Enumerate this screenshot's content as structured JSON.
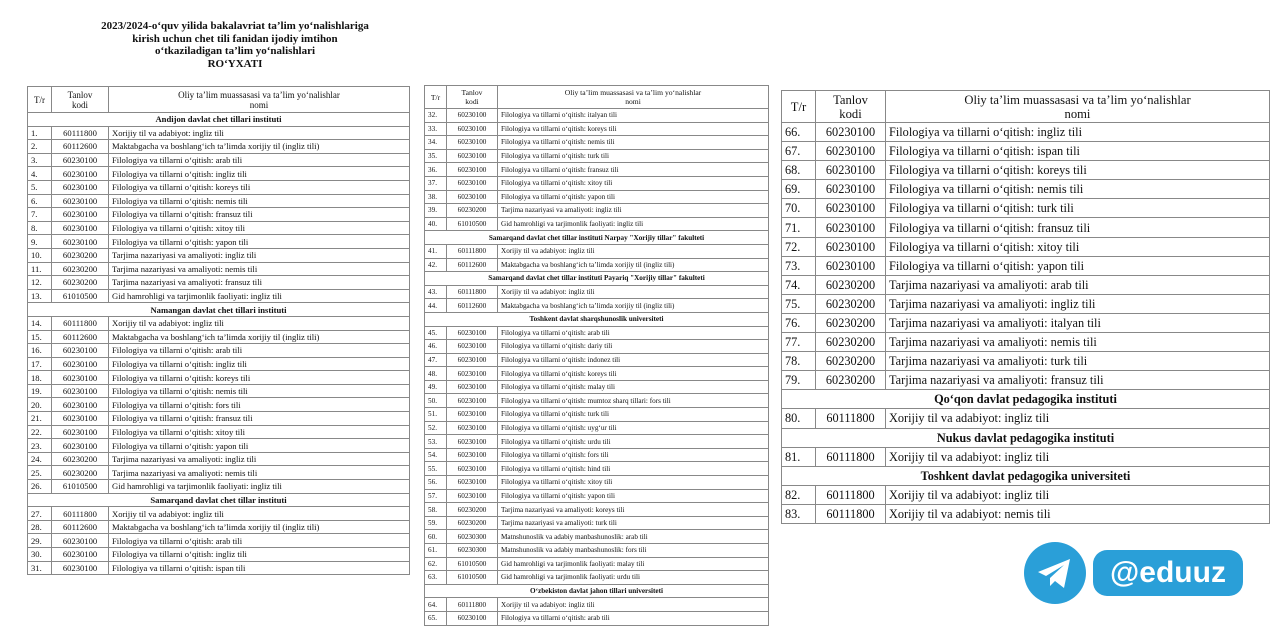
{
  "document": {
    "title_lines": [
      "2023/2024-o‘quv yilida bakalavriat ta’lim yo‘nalishlariga",
      "kirish uchun chet tili fanidan ijodiy imtihon",
      "o‘tkaziladigan ta’lim yo‘nalishlari",
      "RO‘YXATI"
    ],
    "headers": {
      "no": "T/r",
      "code_l1": "Tanlov",
      "code_l2": "kodi",
      "name_l1": "Oliy ta’lim muassasasi va ta’lim yo‘nalishlar",
      "name_l2": "nomi"
    }
  },
  "tables": [
    [
      {
        "type": "sec",
        "text": "Andijon davlat chet tillari instituti"
      },
      {
        "n": "1.",
        "c": "60111800",
        "t": "Xorijiy til va adabiyot: ingliz tili"
      },
      {
        "n": "2.",
        "c": "60112600",
        "t": "Maktabgacha va boshlang‘ich ta’limda xorijiy til (ingliz tili)"
      },
      {
        "n": "3.",
        "c": "60230100",
        "t": "Filologiya va tillarni o‘qitish: arab tili"
      },
      {
        "n": "4.",
        "c": "60230100",
        "t": "Filologiya va tillarni o‘qitish: ingliz tili"
      },
      {
        "n": "5.",
        "c": "60230100",
        "t": "Filologiya va tillarni o‘qitish: koreys tili"
      },
      {
        "n": "6.",
        "c": "60230100",
        "t": "Filologiya va tillarni o‘qitish: nemis tili"
      },
      {
        "n": "7.",
        "c": "60230100",
        "t": "Filologiya va tillarni o‘qitish: fransuz tili"
      },
      {
        "n": "8.",
        "c": "60230100",
        "t": "Filologiya va tillarni o‘qitish: xitoy tili"
      },
      {
        "n": "9.",
        "c": "60230100",
        "t": "Filologiya va tillarni o‘qitish: yapon tili"
      },
      {
        "n": "10.",
        "c": "60230200",
        "t": "Tarjima nazariyasi va amaliyoti: ingliz tili"
      },
      {
        "n": "11.",
        "c": "60230200",
        "t": "Tarjima nazariyasi va amaliyoti: nemis tili"
      },
      {
        "n": "12.",
        "c": "60230200",
        "t": "Tarjima nazariyasi va amaliyoti: fransuz tili"
      },
      {
        "n": "13.",
        "c": "61010500",
        "t": "Gid hamrohligi va tarjimonlik faoliyati: ingliz tili"
      },
      {
        "type": "sec",
        "text": "Namangan davlat chet tillari instituti"
      },
      {
        "n": "14.",
        "c": "60111800",
        "t": "Xorijiy til va adabiyot: ingliz tili"
      },
      {
        "n": "15.",
        "c": "60112600",
        "t": "Maktabgacha va boshlang‘ich ta’limda xorijiy til (ingliz tili)"
      },
      {
        "n": "16.",
        "c": "60230100",
        "t": "Filologiya va tillarni o‘qitish: arab tili"
      },
      {
        "n": "17.",
        "c": "60230100",
        "t": "Filologiya va tillarni o‘qitish: ingliz tili"
      },
      {
        "n": "18.",
        "c": "60230100",
        "t": "Filologiya va tillarni o‘qitish: koreys tili"
      },
      {
        "n": "19.",
        "c": "60230100",
        "t": "Filologiya va tillarni o‘qitish: nemis tili"
      },
      {
        "n": "20.",
        "c": "60230100",
        "t": "Filologiya va tillarni o‘qitish: fors tili"
      },
      {
        "n": "21.",
        "c": "60230100",
        "t": "Filologiya va tillarni o‘qitish: fransuz tili"
      },
      {
        "n": "22.",
        "c": "60230100",
        "t": "Filologiya va tillarni o‘qitish: xitoy tili"
      },
      {
        "n": "23.",
        "c": "60230100",
        "t": "Filologiya va tillarni o‘qitish: yapon tili"
      },
      {
        "n": "24.",
        "c": "60230200",
        "t": "Tarjima nazariyasi va amaliyoti: ingliz tili"
      },
      {
        "n": "25.",
        "c": "60230200",
        "t": "Tarjima nazariyasi va amaliyoti: nemis tili"
      },
      {
        "n": "26.",
        "c": "61010500",
        "t": "Gid hamrohligi va tarjimonlik faoliyati: ingliz tili"
      },
      {
        "type": "sec",
        "text": "Samarqand davlat chet tillar instituti"
      },
      {
        "n": "27.",
        "c": "60111800",
        "t": "Xorijiy til va adabiyot: ingliz tili"
      },
      {
        "n": "28.",
        "c": "60112600",
        "t": "Maktabgacha va boshlang‘ich ta’limda xorijiy til (ingliz tili)"
      },
      {
        "n": "29.",
        "c": "60230100",
        "t": "Filologiya va tillarni o‘qitish: arab tili"
      },
      {
        "n": "30.",
        "c": "60230100",
        "t": "Filologiya va tillarni o‘qitish: ingliz tili"
      },
      {
        "n": "31.",
        "c": "60230100",
        "t": "Filologiya va tillarni o‘qitish: ispan tili"
      }
    ],
    [
      {
        "n": "32.",
        "c": "60230100",
        "t": "Filologiya va tillarni o‘qitish: italyan tili"
      },
      {
        "n": "33.",
        "c": "60230100",
        "t": "Filologiya va tillarni o‘qitish: koreys tili"
      },
      {
        "n": "34.",
        "c": "60230100",
        "t": "Filologiya va tillarni o‘qitish: nemis tili"
      },
      {
        "n": "35.",
        "c": "60230100",
        "t": "Filologiya va tillarni o‘qitish: turk tili"
      },
      {
        "n": "36.",
        "c": "60230100",
        "t": "Filologiya va tillarni o‘qitish: fransuz tili"
      },
      {
        "n": "37.",
        "c": "60230100",
        "t": "Filologiya va tillarni o‘qitish: xitoy tili"
      },
      {
        "n": "38.",
        "c": "60230100",
        "t": "Filologiya va tillarni o‘qitish: yapon tili"
      },
      {
        "n": "39.",
        "c": "60230200",
        "t": "Tarjima nazariyasi va amaliyoti: ingliz tili"
      },
      {
        "n": "40.",
        "c": "61010500",
        "t": "Gid hamrohligi va tarjimonlik faoliyati: ingliz tili"
      },
      {
        "type": "sec",
        "text": "Samarqand davlat chet tillar instituti Narpay \"Xorijiy tillar\" fakulteti"
      },
      {
        "n": "41.",
        "c": "60111800",
        "t": "Xorijiy til va adabiyot: ingliz tili"
      },
      {
        "n": "42.",
        "c": "60112600",
        "t": "Maktabgacha va boshlang‘ich ta’limda xorijiy til (ingliz tili)"
      },
      {
        "type": "sec",
        "text": "Samarqand davlat chet tillar instituti Payariq \"Xorijiy tillar\" fakulteti"
      },
      {
        "n": "43.",
        "c": "60111800",
        "t": "Xorijiy til va adabiyot: ingliz tili"
      },
      {
        "n": "44.",
        "c": "60112600",
        "t": "Maktabgacha va boshlang‘ich ta’limda xorijiy til (ingliz tili)"
      },
      {
        "type": "sec",
        "text": "Toshkent davlat sharqshunoslik universiteti"
      },
      {
        "n": "45.",
        "c": "60230100",
        "t": "Filologiya va tillarni o‘qitish: arab tili"
      },
      {
        "n": "46.",
        "c": "60230100",
        "t": "Filologiya va tillarni o‘qitish: dariy tili"
      },
      {
        "n": "47.",
        "c": "60230100",
        "t": "Filologiya va tillarni o‘qitish: indonez tili"
      },
      {
        "n": "48.",
        "c": "60230100",
        "t": "Filologiya va tillarni o‘qitish: koreys tili"
      },
      {
        "n": "49.",
        "c": "60230100",
        "t": "Filologiya va tillarni o‘qitish: malay tili"
      },
      {
        "n": "50.",
        "c": "60230100",
        "t": "Filologiya va tillarni o‘qitish: mumtoz sharq tillari: fors tili"
      },
      {
        "n": "51.",
        "c": "60230100",
        "t": "Filologiya va tillarni o‘qitish: turk tili"
      },
      {
        "n": "52.",
        "c": "60230100",
        "t": "Filologiya va tillarni o‘qitish: uyg‘ur tili"
      },
      {
        "n": "53.",
        "c": "60230100",
        "t": "Filologiya va tillarni o‘qitish: urdu tili"
      },
      {
        "n": "54.",
        "c": "60230100",
        "t": "Filologiya va tillarni o‘qitish: fors tili"
      },
      {
        "n": "55.",
        "c": "60230100",
        "t": "Filologiya va tillarni o‘qitish: hind tili"
      },
      {
        "n": "56.",
        "c": "60230100",
        "t": "Filologiya va tillarni o‘qitish: xitoy tili"
      },
      {
        "n": "57.",
        "c": "60230100",
        "t": "Filologiya va tillarni o‘qitish: yapon tili"
      },
      {
        "n": "58.",
        "c": "60230200",
        "t": "Tarjima nazariyasi va amaliyoti: koreys tili"
      },
      {
        "n": "59.",
        "c": "60230200",
        "t": "Tarjima nazariyasi va amaliyoti: turk tili"
      },
      {
        "n": "60.",
        "c": "60230300",
        "t": "Matnshunoslik va adabiy manbashunoslik: arab tili"
      },
      {
        "n": "61.",
        "c": "60230300",
        "t": "Matnshunoslik va adabiy manbashunoslik: fors tili"
      },
      {
        "n": "62.",
        "c": "61010500",
        "t": "Gid hamrohligi va tarjimonlik faoliyati: malay tili"
      },
      {
        "n": "63.",
        "c": "61010500",
        "t": "Gid hamrohligi va tarjimonlik faoliyati: urdu tili"
      },
      {
        "type": "sec",
        "text": "O‘zbekiston davlat jahon tillari universiteti"
      },
      {
        "n": "64.",
        "c": "60111800",
        "t": "Xorijiy til va adabiyot: ingliz tili"
      },
      {
        "n": "65.",
        "c": "60230100",
        "t": "Filologiya va tillarni o‘qitish: arab tili"
      }
    ],
    [
      {
        "n": "66.",
        "c": "60230100",
        "t": "Filologiya va tillarni o‘qitish: ingliz tili"
      },
      {
        "n": "67.",
        "c": "60230100",
        "t": "Filologiya va tillarni o‘qitish: ispan tili"
      },
      {
        "n": "68.",
        "c": "60230100",
        "t": "Filologiya va tillarni o‘qitish: koreys tili"
      },
      {
        "n": "69.",
        "c": "60230100",
        "t": "Filologiya va tillarni o‘qitish: nemis tili"
      },
      {
        "n": "70.",
        "c": "60230100",
        "t": "Filologiya va tillarni o‘qitish: turk tili"
      },
      {
        "n": "71.",
        "c": "60230100",
        "t": "Filologiya va tillarni o‘qitish: fransuz tili"
      },
      {
        "n": "72.",
        "c": "60230100",
        "t": "Filologiya va tillarni o‘qitish: xitoy tili"
      },
      {
        "n": "73.",
        "c": "60230100",
        "t": "Filologiya va tillarni o‘qitish: yapon tili"
      },
      {
        "n": "74.",
        "c": "60230200",
        "t": "Tarjima nazariyasi va amaliyoti: arab tili"
      },
      {
        "n": "75.",
        "c": "60230200",
        "t": "Tarjima nazariyasi va amaliyoti: ingliz tili"
      },
      {
        "n": "76.",
        "c": "60230200",
        "t": "Tarjima nazariyasi va amaliyoti: italyan tili"
      },
      {
        "n": "77.",
        "c": "60230200",
        "t": "Tarjima nazariyasi va amaliyoti: nemis tili"
      },
      {
        "n": "78.",
        "c": "60230200",
        "t": "Tarjima nazariyasi va amaliyoti: turk tili"
      },
      {
        "n": "79.",
        "c": "60230200",
        "t": "Tarjima nazariyasi va amaliyoti: fransuz tili"
      },
      {
        "type": "sec",
        "text": "Qo‘qon davlat pedagogika instituti"
      },
      {
        "n": "80.",
        "c": "60111800",
        "t": "Xorijiy til va adabiyot: ingliz tili"
      },
      {
        "type": "sec",
        "text": "Nukus davlat pedagogika instituti"
      },
      {
        "n": "81.",
        "c": "60111800",
        "t": "Xorijiy til va adabiyot: ingliz tili"
      },
      {
        "type": "sec",
        "text": "Toshkent davlat pedagogika universiteti"
      },
      {
        "n": "82.",
        "c": "60111800",
        "t": "Xorijiy til va adabiyot: ingliz tili"
      },
      {
        "n": "83.",
        "c": "60111800",
        "t": "Xorijiy til va adabiyot: nemis tili"
      }
    ]
  ],
  "watermark": {
    "text": "@eduuz",
    "icon": "telegram-icon",
    "color": "#2a9fd8"
  }
}
